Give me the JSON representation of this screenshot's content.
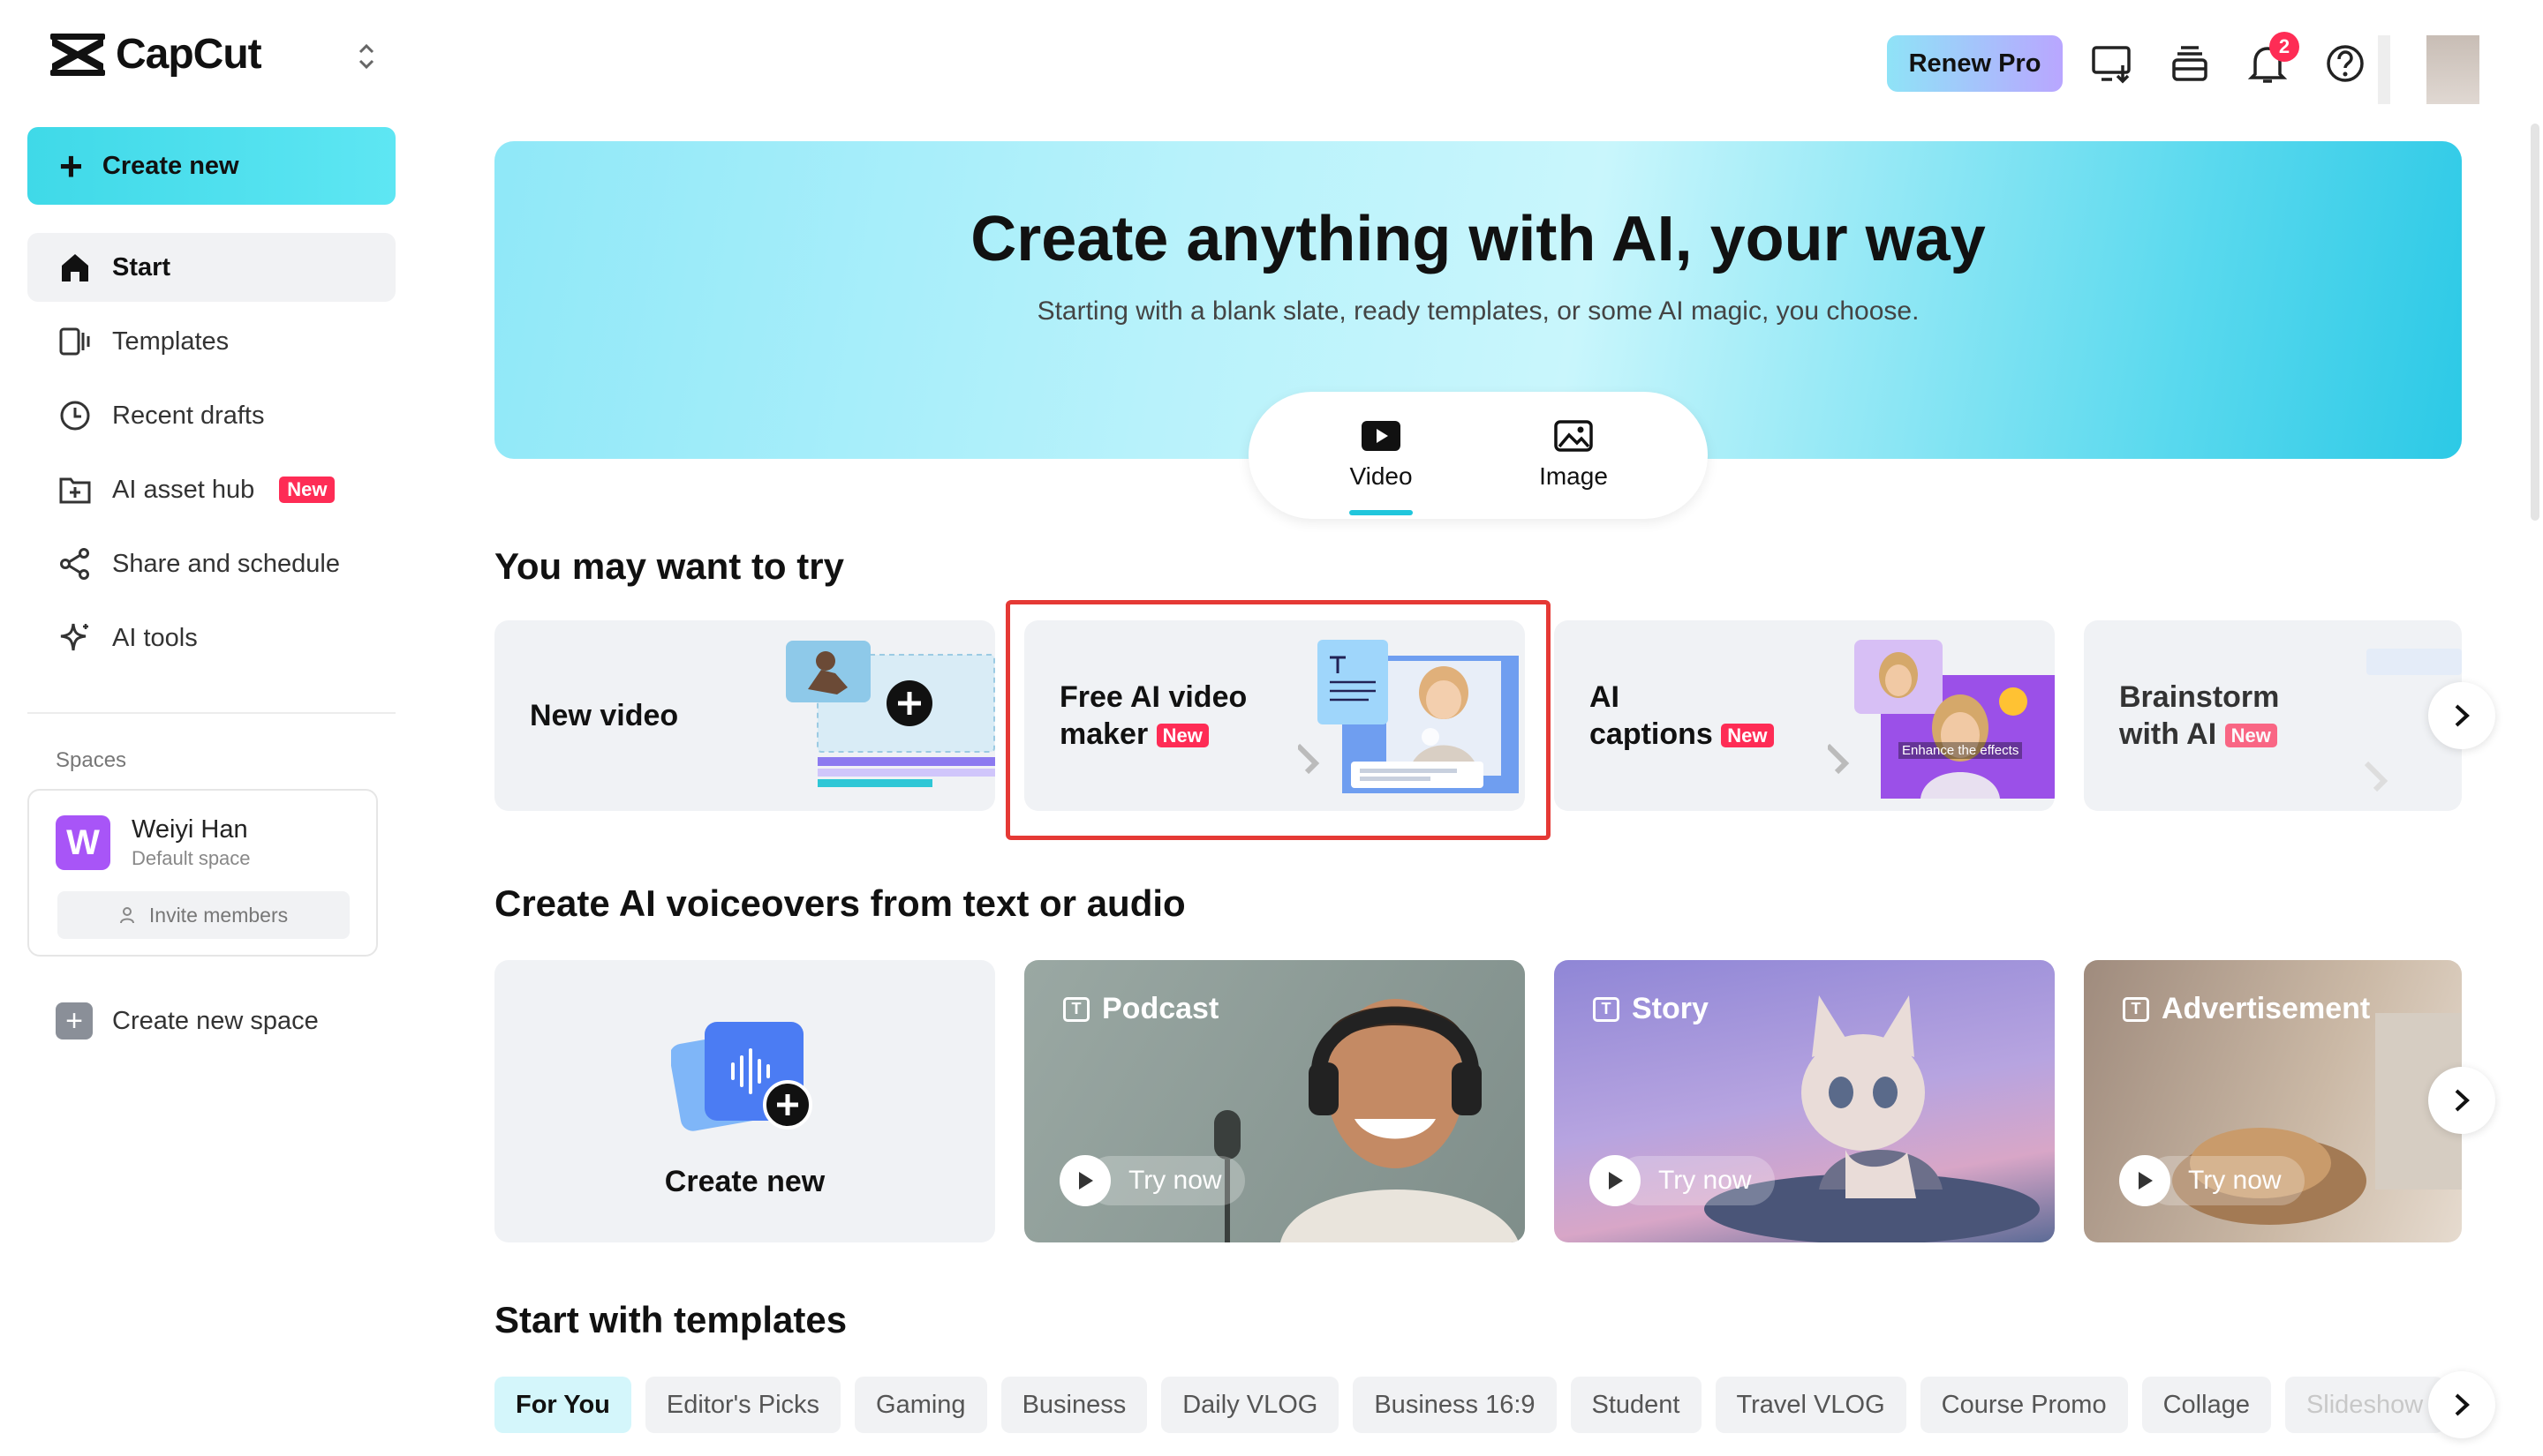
{
  "app": {
    "name": "CapCut"
  },
  "sidebar": {
    "create_label": "Create new",
    "items": [
      {
        "label": "Start",
        "icon": "home-icon",
        "active": true
      },
      {
        "label": "Templates",
        "icon": "templates-icon"
      },
      {
        "label": "Recent drafts",
        "icon": "clock-icon"
      },
      {
        "label": "AI asset hub",
        "icon": "asset-hub-icon",
        "badge": "New"
      },
      {
        "label": "Share and schedule",
        "icon": "share-icon"
      },
      {
        "label": "AI tools",
        "icon": "sparkle-icon"
      }
    ],
    "spaces_heading": "Spaces",
    "space": {
      "initial": "W",
      "name": "Weiyi Han",
      "subtitle": "Default space",
      "invite_label": "Invite members"
    },
    "new_space_label": "Create new space"
  },
  "header": {
    "renew_label": "Renew Pro",
    "notification_count": "2",
    "icons": [
      "monitor-download-icon",
      "stack-icon",
      "bell-icon",
      "help-icon"
    ]
  },
  "hero": {
    "title": "Create anything with AI, your way",
    "subtitle": "Starting with a blank slate, ready templates, or some AI magic, you choose.",
    "modes": [
      {
        "label": "Video",
        "active": true
      },
      {
        "label": "Image"
      }
    ]
  },
  "try_section": {
    "title": "You may want to try",
    "cards": [
      {
        "line1": "New video",
        "line2": ""
      },
      {
        "line1": "Free AI video",
        "line2": "maker",
        "badge": "New"
      },
      {
        "line1": "AI",
        "line2": "captions",
        "badge": "New",
        "overlay": "Enhance the effects"
      },
      {
        "line1": "Brainstorm",
        "line2": "with AI",
        "badge": "New"
      }
    ]
  },
  "voice_section": {
    "title": "Create AI voiceovers from text or audio",
    "create_label": "Create new",
    "try_label": "Try now",
    "cards": [
      {
        "title": "Podcast"
      },
      {
        "title": "Story"
      },
      {
        "title": "Advertisement"
      }
    ]
  },
  "templates_section": {
    "title": "Start with templates",
    "chips": [
      "For You",
      "Editor's Picks",
      "Gaming",
      "Business",
      "Daily VLOG",
      "Business 16:9",
      "Student",
      "Travel VLOG",
      "Course Promo",
      "Collage",
      "Slideshow"
    ]
  },
  "colors": {
    "accent": "#3fd9e8",
    "new_badge": "#fe2c55",
    "highlight": "#e53935"
  }
}
